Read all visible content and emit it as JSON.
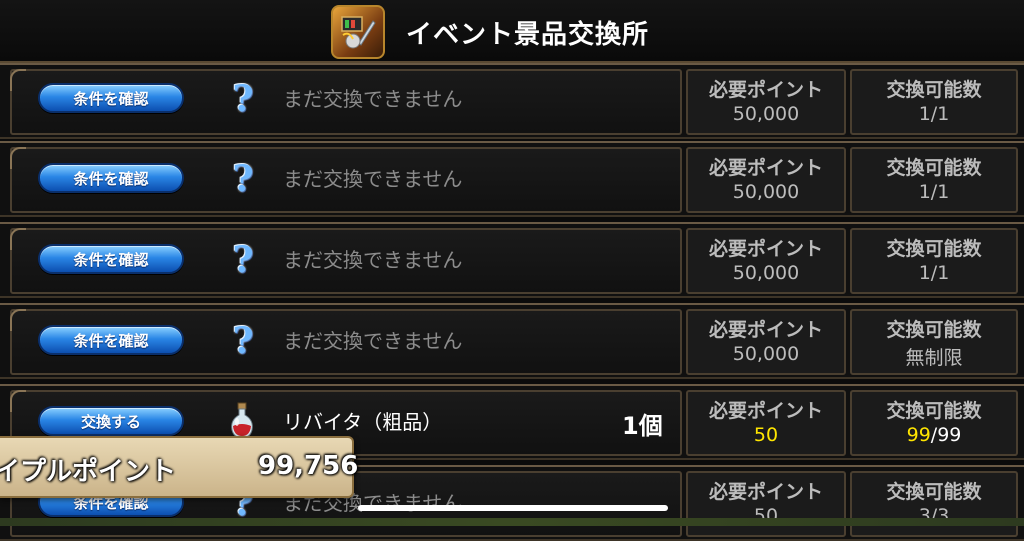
{
  "header": {
    "title": "イベント景品交換所",
    "icon": "event-prize-icon"
  },
  "columns": {
    "points_label": "必要ポイント",
    "count_label": "交換可能数"
  },
  "rows": [
    {
      "button": "条件を確認",
      "icon": "question-icon",
      "name": "まだ交換できません",
      "quantity": "",
      "points": "50,000",
      "count": "1/1",
      "locked": true
    },
    {
      "button": "条件を確認",
      "icon": "question-icon",
      "name": "まだ交換できません",
      "quantity": "",
      "points": "50,000",
      "count": "1/1",
      "locked": true
    },
    {
      "button": "条件を確認",
      "icon": "question-icon",
      "name": "まだ交換できません",
      "quantity": "",
      "points": "50,000",
      "count": "1/1",
      "locked": true
    },
    {
      "button": "条件を確認",
      "icon": "question-icon",
      "name": "まだ交換できません",
      "quantity": "",
      "points": "50,000",
      "count": "無制限",
      "locked": true
    },
    {
      "button": "交換する",
      "icon": "potion-icon",
      "name": "リバイタ（粗品）",
      "quantity": "1個",
      "points": "50",
      "count_available": "99",
      "count_sep": "/",
      "count_max": "99",
      "locked": false
    },
    {
      "button": "条件を確認",
      "icon": "question-icon",
      "name": "まだ交換できません",
      "quantity": "",
      "points": "50",
      "count": "3/3",
      "locked": true
    }
  ],
  "footer": {
    "label": "イプルポイント",
    "value": "99,756"
  },
  "colors": {
    "button_blue": "#2a86e6",
    "highlight_yellow": "#ffe600",
    "panel_border": "#4a3f30"
  }
}
